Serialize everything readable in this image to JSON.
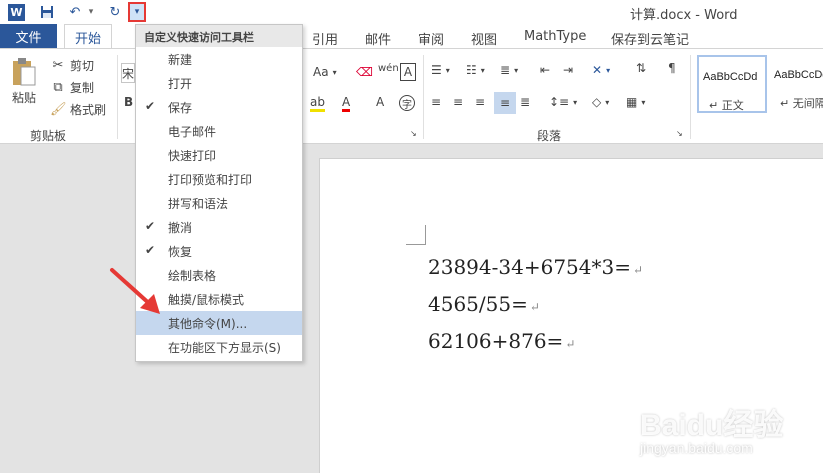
{
  "window": {
    "title": "计算.docx - Word"
  },
  "qat": {
    "logo": "W",
    "save_icon": "save-icon",
    "undo_icon": "undo-icon",
    "redo_icon": "redo-icon",
    "dropdown_glyph": "▾"
  },
  "tabs": {
    "file": "文件",
    "home": "开始",
    "others": [
      "引用",
      "邮件",
      "审阅",
      "视图",
      "MathType",
      "保存到云笔记"
    ]
  },
  "ribbon": {
    "clipboard": {
      "paste": "粘贴",
      "cut": "剪切",
      "copy": "复制",
      "format_painter": "格式刷",
      "group_label": "剪贴板"
    },
    "font": {
      "font_name_fragment": "宋",
      "bold_fragment": "B",
      "case_label": "Aa"
    },
    "paragraph": {
      "group_label": "段落"
    },
    "styles": [
      {
        "sample": "AaBbCcDd",
        "name": "↵ 正文"
      },
      {
        "sample": "AaBbCcDd",
        "name": "↵ 无间隔"
      }
    ]
  },
  "menu": {
    "header": "自定义快速访问工具栏",
    "items": [
      {
        "label": "新建",
        "checked": false
      },
      {
        "label": "打开",
        "checked": false
      },
      {
        "label": "保存",
        "checked": true
      },
      {
        "label": "电子邮件",
        "checked": false
      },
      {
        "label": "快速打印",
        "checked": false
      },
      {
        "label": "打印预览和打印",
        "checked": false
      },
      {
        "label": "拼写和语法",
        "checked": false
      },
      {
        "label": "撤消",
        "checked": true
      },
      {
        "label": "恢复",
        "checked": true
      },
      {
        "label": "绘制表格",
        "checked": false
      },
      {
        "label": "触摸/鼠标模式",
        "checked": false
      },
      {
        "label": "其他命令(M)...",
        "checked": false,
        "highlighted": true
      },
      {
        "label": "在功能区下方显示(S)",
        "checked": false
      }
    ]
  },
  "document": {
    "lines": [
      "23894-34+6754*3=",
      "4565/55=",
      "62106+876="
    ],
    "para_mark": "↵"
  },
  "watermark": {
    "brand": "Baidu经验",
    "url": "jingyan.baidu.com"
  },
  "colors": {
    "accent": "#2b579a",
    "highlight_border": "#e53935",
    "menu_highlight": "#c5d7ee",
    "arrow": "#e53935"
  }
}
